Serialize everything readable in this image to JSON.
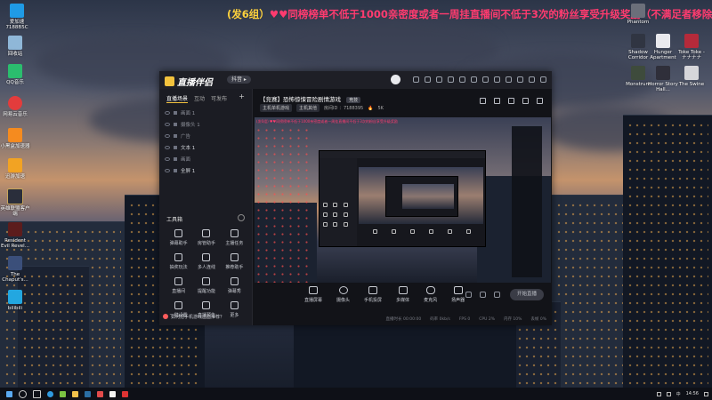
{
  "banner": {
    "part1": "(发6组）",
    "part2": "♥♥同榜榜单不低于1000亲密度或者一周挂直播间不低于3次的粉丝享受升级奖励（不满足者移除",
    "part2_overflow": "除"
  },
  "desktop_icons_left": [
    {
      "label": "爱加速 7188B5C"
    },
    {
      "label": "回收站"
    },
    {
      "label": "QQ音乐"
    },
    {
      "label": "网易云音乐"
    },
    {
      "label": "小黑盒加速器"
    },
    {
      "label": "迅游加速"
    },
    {
      "label": "英雄联盟客户端"
    },
    {
      "label": "Resident Evil Revel..."
    },
    {
      "label": "The Chaput's..."
    },
    {
      "label": "bilibili"
    }
  ],
  "desktop_icons_right": [
    {
      "label": "Phantom"
    },
    {
      "label": "Shadow Corridor"
    },
    {
      "label": "Hunger Apartment"
    },
    {
      "label": "Toke Toke - ナナナナ"
    },
    {
      "label": "Monstrum"
    },
    {
      "label": "Horror Story Hall..."
    },
    {
      "label": "The Swine"
    }
  ],
  "app": {
    "name": "直播伴侣",
    "version_pill": "抖音 ▸",
    "left_tabs": [
      "直播场景",
      "互动",
      "可发布"
    ],
    "scenes": [
      {
        "label": "画面 1"
      },
      {
        "label": "摄像头 1"
      },
      {
        "label": "广告"
      },
      {
        "label": "文本 1"
      },
      {
        "label": "画面"
      },
      {
        "label": "全屏 1"
      }
    ],
    "tools_title": "工具箱",
    "tools": [
      {
        "label": "弹幕助手"
      },
      {
        "label": "房管助手"
      },
      {
        "label": "主播任务"
      },
      {
        "label": "抽奖玩法"
      },
      {
        "label": "多人连线"
      },
      {
        "label": "推荐助手"
      },
      {
        "label": "直播间"
      },
      {
        "label": "提醒功能"
      },
      {
        "label": "弹幕秀"
      },
      {
        "label": "一键设置"
      },
      {
        "label": "直播预告"
      },
      {
        "label": "更多"
      }
    ],
    "tip": "如何把手机游戏画面推荐？",
    "room_title": "【竞赛】恐怖惊悚冒险剧情游戏",
    "room_tag": "竞技",
    "room_meta": [
      "主机单机游戏",
      "主机其他",
      "房间ID ：7188395",
      "5K"
    ],
    "preview_caption": "(发6组) ♥♥同榜榜单不低于1000亲密度或者一周挂直播间不低于3次的粉丝享受升级奖励",
    "bottom_tools": [
      {
        "label": "直播屏幕"
      },
      {
        "label": "摄像头"
      },
      {
        "label": "手机投屏"
      },
      {
        "label": "多媒体"
      },
      {
        "label": "麦克风"
      },
      {
        "label": "扬声器"
      }
    ],
    "start_button": "开始直播",
    "status": [
      "直播时长 00:00:00",
      "码率 0kb/s",
      "FPS 0",
      "CPU 2%",
      "内存 10%",
      "丢帧 0%"
    ]
  },
  "taskbar": {
    "time": "14:56",
    "lang": "中"
  }
}
